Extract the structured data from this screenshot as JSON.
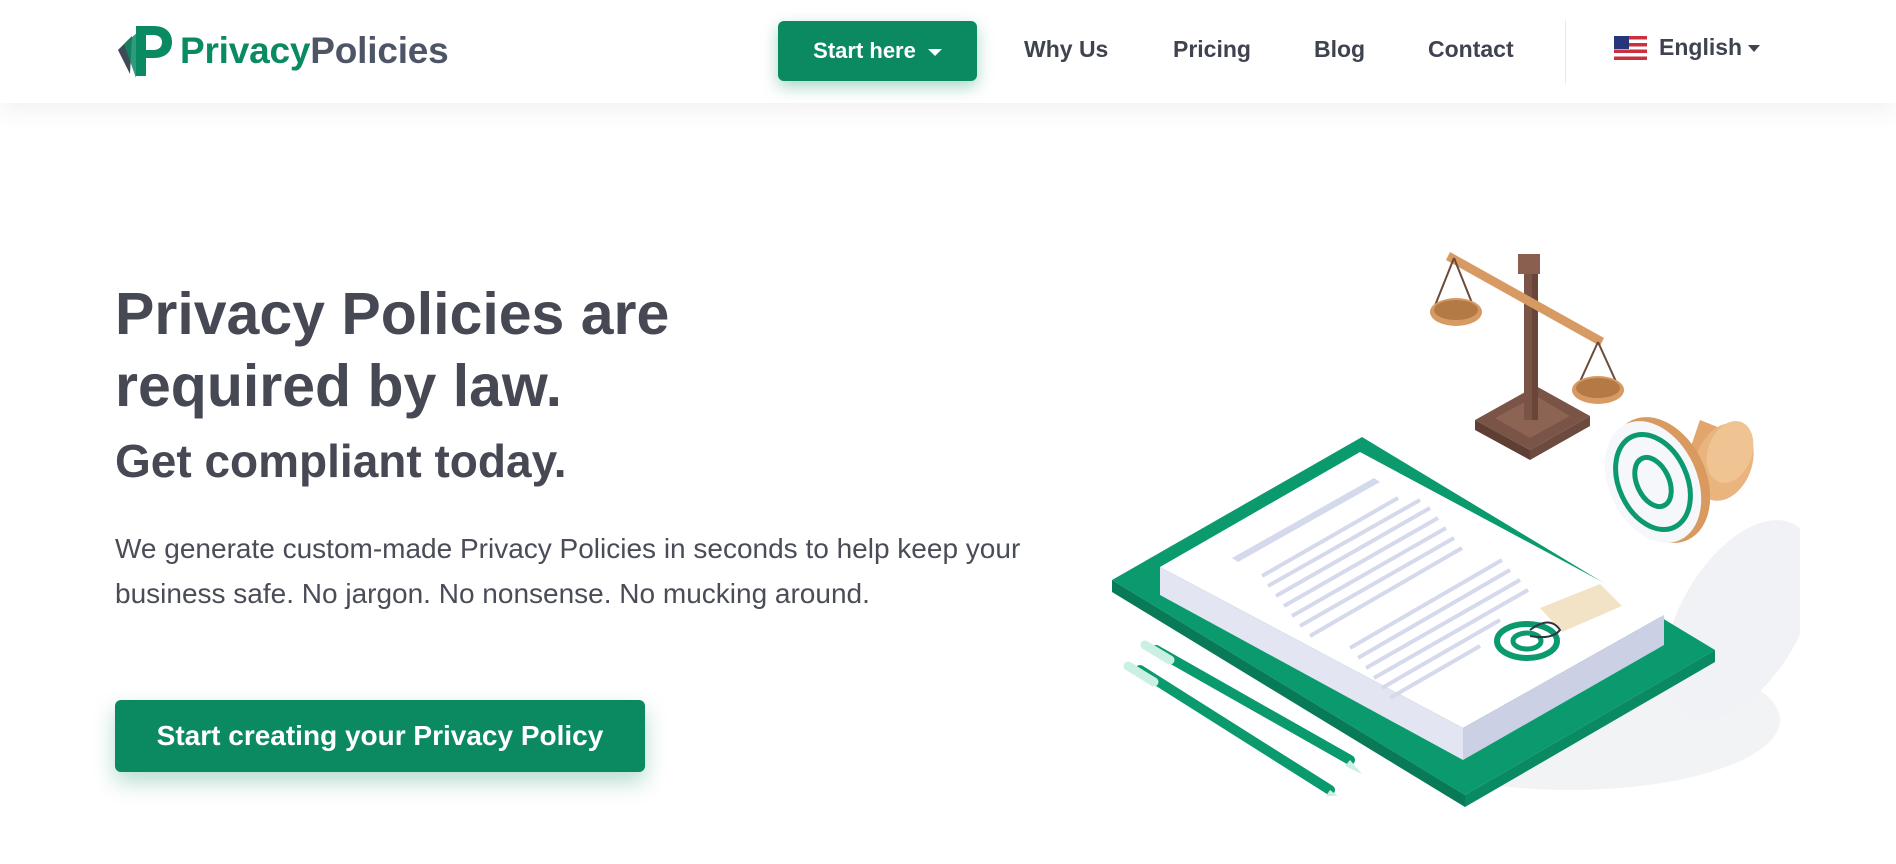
{
  "brand": {
    "name_part1": "Privacy",
    "name_part2": "Policies",
    "primary_color": "#0b8a62",
    "text_color": "#464954"
  },
  "nav": {
    "start_label": "Start here",
    "links": [
      "Why Us",
      "Pricing",
      "Blog",
      "Contact"
    ],
    "language": "English",
    "flag_icon": "us-flag-icon"
  },
  "hero": {
    "headline_line1": "Privacy Policies are",
    "headline_line2": "required by law.",
    "subheadline": "Get compliant today.",
    "lead": "We generate custom-made Privacy Policies in seconds to help keep your business safe. No jargon. No nonsense. No mucking around.",
    "cta_label": "Start creating your Privacy Policy"
  },
  "illustration": {
    "icons": [
      "scales-of-justice-icon",
      "rubber-stamp-icon",
      "document-icon",
      "pens-icon"
    ]
  }
}
